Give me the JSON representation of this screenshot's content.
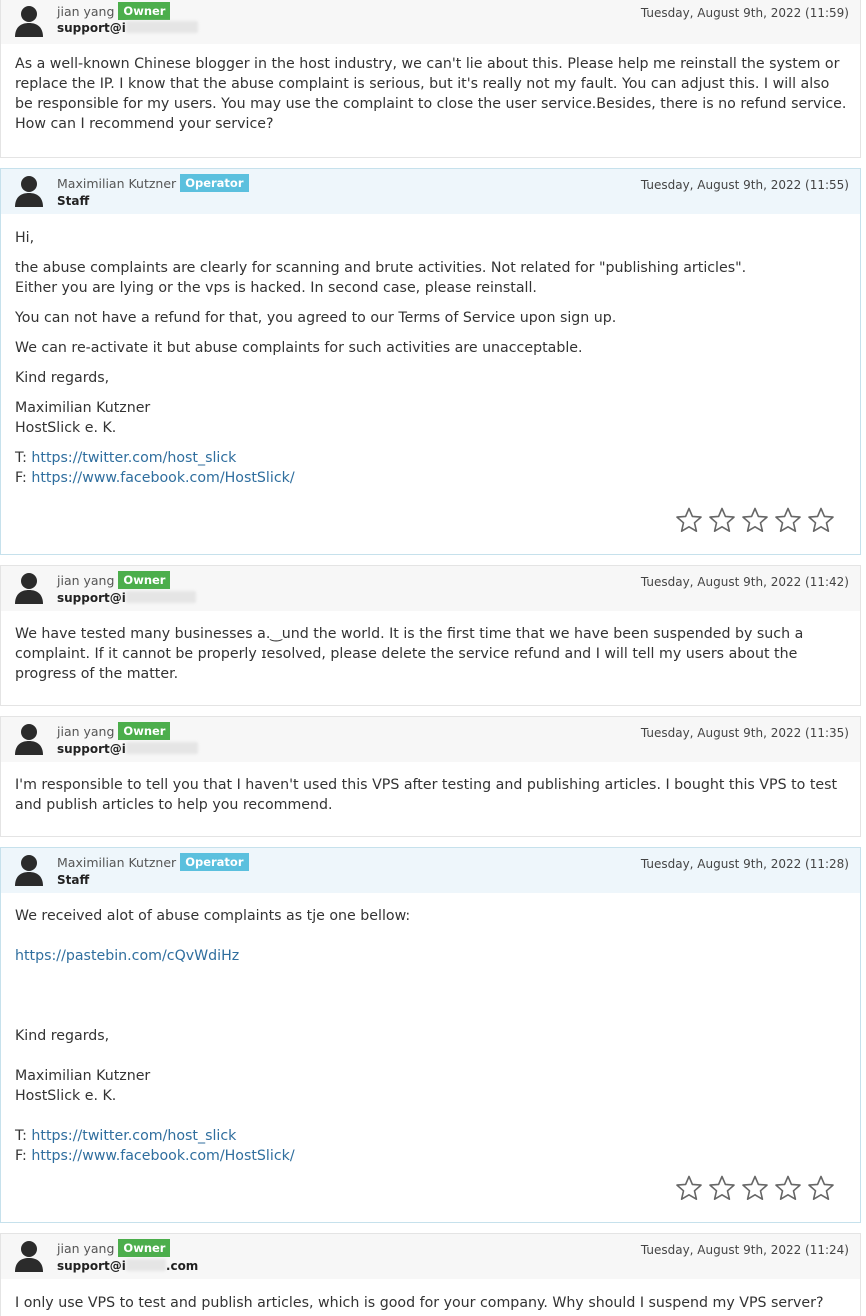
{
  "messages": [
    {
      "name": "jian yang",
      "badge": "Owner",
      "sub": "support@i",
      "date": "Tuesday, August 9th, 2022 (11:59)",
      "text": "As a well-known Chinese blogger in the host industry, we can't lie about this. Please help me reinstall the system or replace the IP. I know that the abuse complaint is serious, but it's really not my fault. You can adjust this. I will also be responsible for my users. You may use the complaint to close the user service.Besides, there is no refund service. How can I recommend your service?"
    },
    {
      "name": "Maximilian Kutzner",
      "badge": "Operator",
      "sub": "Staff",
      "date": "Tuesday, August 9th, 2022 (11:55)",
      "greeting": "Hi,",
      "para1_line1": "the abuse complaints are clearly for scanning and brute activities. Not related for \"publishing articles\".",
      "para1_line2": "Either you are lying or the vps is hacked. In second case, please reinstall.",
      "para2": "You can not have a refund for that, you agreed to our Terms of Service upon sign up.",
      "para3": "We can re-activate it but abuse complaints for such activities are unacceptable.",
      "closing": "Kind regards,",
      "sig_name": "Maximilian Kutzner",
      "sig_company": "HostSlick e. K.",
      "twitter_prefix": "T:",
      "twitter_link": "https://twitter.com/host_slick",
      "facebook_prefix": "F:",
      "facebook_link": "https://www.facebook.com/HostSlick/",
      "rating": 0
    },
    {
      "name": "jian yang",
      "badge": "Owner",
      "sub": "support@i",
      "date": "Tuesday, August 9th, 2022 (11:42)",
      "text": "We have tested many businesses a.‿und the world. It is the first time that we have been suspended by such a complaint. If it cannot be properly ɪesolved, please delete the service refund and I will tell my users about the progress of the matter."
    },
    {
      "name": "jian yang",
      "badge": "Owner",
      "sub": "support@i",
      "date": "Tuesday, August 9th, 2022 (11:35)",
      "text": "I'm responsible to tell you that I haven't used this VPS after testing and publishing articles. I bought this VPS to test and publish articles to help you recommend."
    },
    {
      "name": "Maximilian Kutzner",
      "badge": "Operator",
      "sub": "Staff",
      "date": "Tuesday, August 9th, 2022 (11:28)",
      "para1": "We received alot of abuse complaints as tje one bellow:",
      "pastebin_link": "https://pastebin.com/cQvWdiHz",
      "closing": "Kind regards,",
      "sig_name": "Maximilian Kutzner",
      "sig_company": "HostSlick e. K.",
      "twitter_prefix": "T:",
      "twitter_link": "https://twitter.com/host_slick",
      "facebook_prefix": "F:",
      "facebook_link": "https://www.facebook.com/HostSlick/",
      "rating": 0
    },
    {
      "name": "jian yang",
      "badge": "Owner",
      "sub": "support@i",
      "sub_tail": ".com",
      "date": "Tuesday, August 9th, 2022 (11:24)",
      "text": "I only use VPS to test and publish articles, which is good for your company. Why should I suspend my VPS server?"
    }
  ],
  "icons": {
    "avatar": "user-silhouette-icon",
    "star": "star-outline-icon"
  },
  "colors": {
    "owner_badge": "#4cae4c",
    "operator_badge": "#5bc0de",
    "staff_header": "#eef6fb",
    "client_header": "#f7f7f7",
    "link": "#2f6e9e",
    "star_stroke": "#666666"
  }
}
